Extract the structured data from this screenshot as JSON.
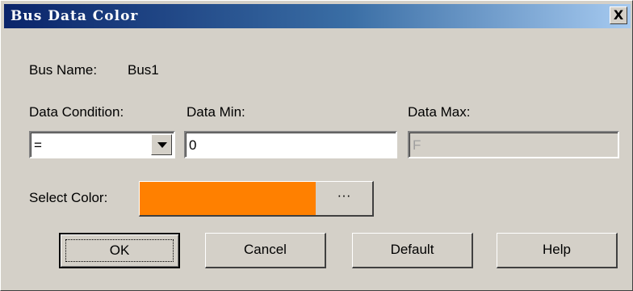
{
  "window": {
    "title": "Bus Data Color",
    "close_symbol": "X"
  },
  "bus": {
    "name_label": "Bus Name:",
    "name_value": "Bus1"
  },
  "condition": {
    "label": "Data Condition:",
    "value": "="
  },
  "data_min": {
    "label": "Data Min:",
    "value": "0"
  },
  "data_max": {
    "label": "Data Max:",
    "value": "F"
  },
  "color": {
    "label": "Select Color:",
    "swatch_color": "#ff8000",
    "more_label": "···"
  },
  "buttons": {
    "ok": "OK",
    "cancel": "Cancel",
    "default": "Default",
    "help": "Help"
  }
}
